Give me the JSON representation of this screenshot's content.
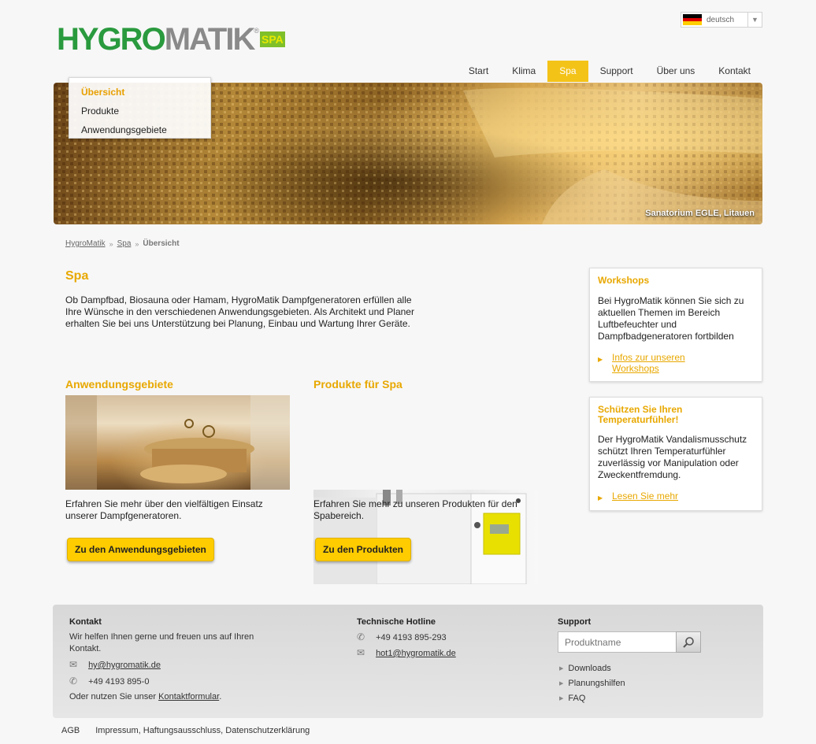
{
  "logo": {
    "part1": "HYGRO",
    "part2": "MATIK",
    "registered": "®",
    "badge": "SPA"
  },
  "language": {
    "label": "deutsch",
    "flag_colors": [
      "#000000",
      "#dd0000",
      "#ffce00"
    ]
  },
  "nav": {
    "items": [
      {
        "label": "Start"
      },
      {
        "label": "Klima"
      },
      {
        "label": "Spa",
        "active": true
      },
      {
        "label": "Support"
      },
      {
        "label": "Über uns"
      },
      {
        "label": "Kontakt"
      }
    ]
  },
  "dropdown": {
    "items": [
      {
        "label": "Übersicht",
        "active": true
      },
      {
        "label": "Produkte"
      },
      {
        "label": "Anwendungsgebiete"
      }
    ]
  },
  "banner": {
    "caption": "Sanatorium EGLE, Litauen"
  },
  "breadcrumb": {
    "items": [
      "HygroMatik",
      "Spa"
    ],
    "current": "Übersicht",
    "separator": "»"
  },
  "main": {
    "title": "Spa",
    "intro": "Ob Dampfbad, Biosauna oder Hamam, HygroMatik Dampfgeneratoren erfüllen alle Ihre Wünsche in den verschiedenen Anwendungsgebieten. Als Architekt und Planer erhalten Sie bei uns Unterstützung bei Planung, Einbau und Wartung Ihrer Geräte.",
    "col1": {
      "title": "Anwendungsgebiete",
      "text": "Erfahren Sie mehr über den vielfältigen Einsatz unserer Dampfgeneratoren.",
      "button": "Zu den Anwendungsgebieten"
    },
    "col2": {
      "title": "Produkte für Spa",
      "text": "Erfahren Sie mehr zu unseren Produkten für den Spabereich.",
      "button": "Zu den Produkten"
    }
  },
  "sidebar": {
    "box1": {
      "title": "Workshops",
      "text": "Bei HygroMatik können Sie sich zu aktuellen Themen im Bereich Luftbefeuchter und Dampfbadgeneratoren fortbilden",
      "link": "Infos zur unseren Workshops"
    },
    "box2": {
      "title": "Schützen Sie Ihren Temperaturfühler!",
      "text": "Der HygroMatik Vandalismusschutz schützt Ihren Temperaturfühler zuverlässig vor Manipulation oder Zweckentfremdung.",
      "link": "Lesen Sie mehr"
    }
  },
  "footer": {
    "kontakt": {
      "heading": "Kontakt",
      "text": "Wir helfen Ihnen gerne und freuen uns auf Ihren Kontakt.",
      "email": "hy@hygromatik.de",
      "phone": "+49 4193 895-0",
      "form_prefix": "Oder nutzen Sie unser",
      "form_link": "Kontaktformular",
      "form_suffix": "."
    },
    "hotline": {
      "heading": "Technische Hotline",
      "phone": "+49 4193 895-293",
      "email": "hot1@hygromatik.de"
    },
    "support": {
      "heading": "Support",
      "search_placeholder": "Produktname",
      "links": [
        "Downloads",
        "Planungshilfen",
        "FAQ"
      ]
    }
  },
  "bottom": {
    "agb": "AGB",
    "legal": "Impressum, Haftungsausschluss, Datenschutzerklärung"
  }
}
